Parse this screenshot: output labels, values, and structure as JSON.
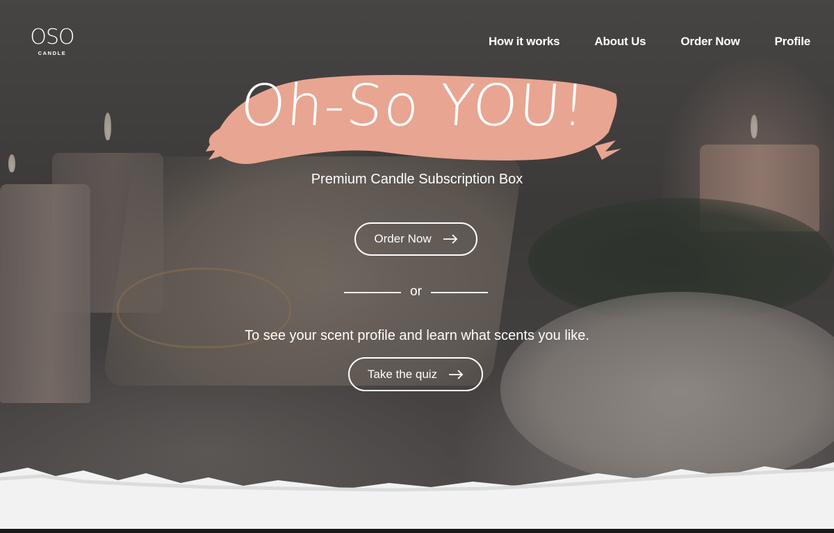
{
  "brand": {
    "logo_mark": "OSO",
    "logo_sub": "CANDLE"
  },
  "nav": {
    "items": [
      {
        "label": "How it works"
      },
      {
        "label": "About Us"
      },
      {
        "label": "Order Now"
      },
      {
        "label": "Profile"
      }
    ]
  },
  "hero": {
    "title": "Oh-So YOU!",
    "subtitle": "Premium Candle Subscription Box",
    "order_button": "Order Now",
    "divider_text": "or",
    "quiz_prompt": "To see your scent profile and learn what scents you like.",
    "quiz_button": "Take the quiz"
  },
  "colors": {
    "brush": "#e8a591",
    "text": "#ffffff",
    "torn_paper": "#f2f2f2"
  },
  "icons": {
    "button_arrow": "arrow-right-icon"
  }
}
